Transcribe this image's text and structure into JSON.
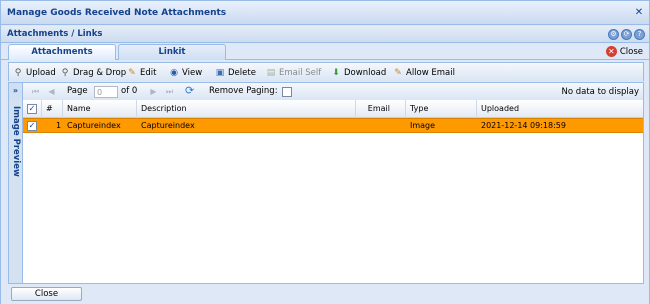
{
  "window": {
    "title": "Manage Goods Received Note Attachments",
    "close_glyph": "✕"
  },
  "panel": {
    "title": "Attachments / Links",
    "tools": [
      "gear-icon",
      "refresh-icon",
      "help-icon"
    ]
  },
  "tabs": [
    {
      "label": "Attachments",
      "active": true
    },
    {
      "label": "Linkit",
      "active": false
    }
  ],
  "top_close_label": "Close",
  "toolbar": {
    "upload": "Upload",
    "drag_drop": "Drag & Drop",
    "edit": "Edit",
    "view": "View",
    "delete": "Delete",
    "email_self": "Email Self",
    "download": "Download",
    "allow_email": "Allow Email"
  },
  "pager": {
    "page_label": "Page",
    "page_value": "0",
    "of_label": "of 0",
    "remove_paging_label": "Remove Paging:",
    "no_data": "No data to display"
  },
  "side_panel": {
    "title": "Image Preview"
  },
  "grid": {
    "columns": [
      "#",
      "Name",
      "Description",
      "Email",
      "Type",
      "Uploaded"
    ],
    "rows": [
      {
        "checked": true,
        "index": "1",
        "name": "Captureindex",
        "description": "Captureindex",
        "email": "",
        "type": "Image",
        "uploaded": "2021-12-14 09:18:59"
      }
    ]
  },
  "footer": {
    "close_label": "Close"
  },
  "colors": {
    "selected_row": "#ff9900",
    "frame": "#99bbe8",
    "title_text": "#15428b"
  }
}
